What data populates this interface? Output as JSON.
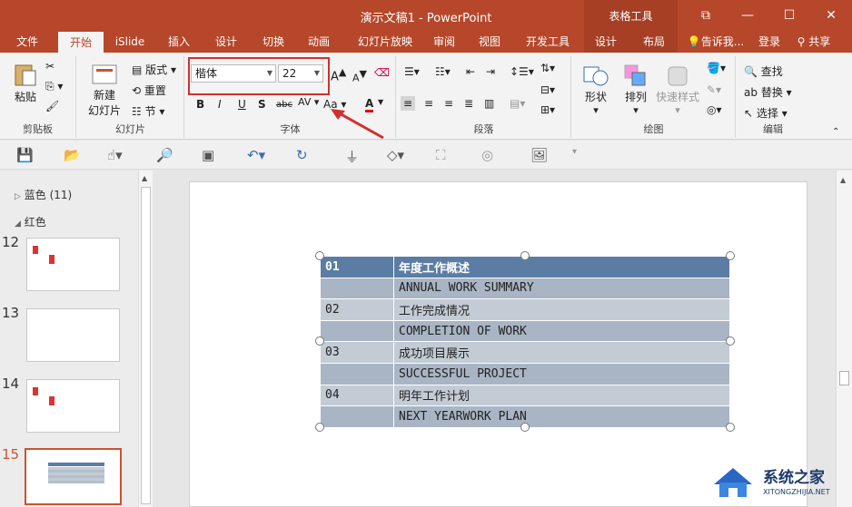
{
  "window": {
    "title": "演示文稿1 - PowerPoint",
    "context_tab": "表格工具"
  },
  "tabs": [
    "文件",
    "开始",
    "iSlide",
    "插入",
    "设计",
    "切换",
    "动画",
    "幻灯片放映",
    "审阅",
    "视图",
    "开发工具",
    "设计",
    "布局"
  ],
  "tell_me": "告诉我...",
  "login": "登录",
  "share": "共享",
  "ribbon": {
    "clipboard": {
      "paste": "粘贴",
      "label": "剪贴板"
    },
    "slides": {
      "new_slide_1": "新建",
      "new_slide_2": "幻灯片",
      "layout": "版式",
      "reset": "重置",
      "section": "节",
      "label": "幻灯片"
    },
    "font": {
      "font_name": "楷体",
      "font_size": "22",
      "bold": "B",
      "italic": "I",
      "underline": "U",
      "shadow": "S",
      "strike": "abc",
      "spacing": "AV",
      "case": "Aa",
      "color": "A",
      "grow": "A",
      "shrink": "A",
      "label": "字体"
    },
    "paragraph": {
      "label": "段落"
    },
    "drawing": {
      "shape": "形状",
      "arrange": "排列",
      "quick_style": "快速样式",
      "label": "绘图"
    },
    "editing": {
      "find": "查找",
      "replace": "替换",
      "select": "选择",
      "label": "编辑"
    }
  },
  "panel": {
    "section_blue": "蓝色 (11)",
    "section_red": "红色",
    "slides": [
      {
        "num": "12"
      },
      {
        "num": "13"
      },
      {
        "num": "14"
      },
      {
        "num": "15"
      }
    ]
  },
  "table": {
    "rows": [
      {
        "c1": "01",
        "c2": "年度工作概述"
      },
      {
        "c1": "",
        "c2": "ANNUAL WORK SUMMARY"
      },
      {
        "c1": "02",
        "c2": "工作完成情况"
      },
      {
        "c1": "",
        "c2": "COMPLETION OF WORK"
      },
      {
        "c1": "03",
        "c2": "成功项目展示"
      },
      {
        "c1": "",
        "c2": "SUCCESSFUL PROJECT"
      },
      {
        "c1": "04",
        "c2": "明年工作计划"
      },
      {
        "c1": "",
        "c2": "NEXT YEARWORK PLAN"
      }
    ]
  },
  "watermark": {
    "brand": "系统之家",
    "url": "XITONGZHIJIA.NET"
  },
  "colors": {
    "accent": "#b7472a",
    "table_header": "#5b7da3",
    "highlight": "#d03030"
  }
}
